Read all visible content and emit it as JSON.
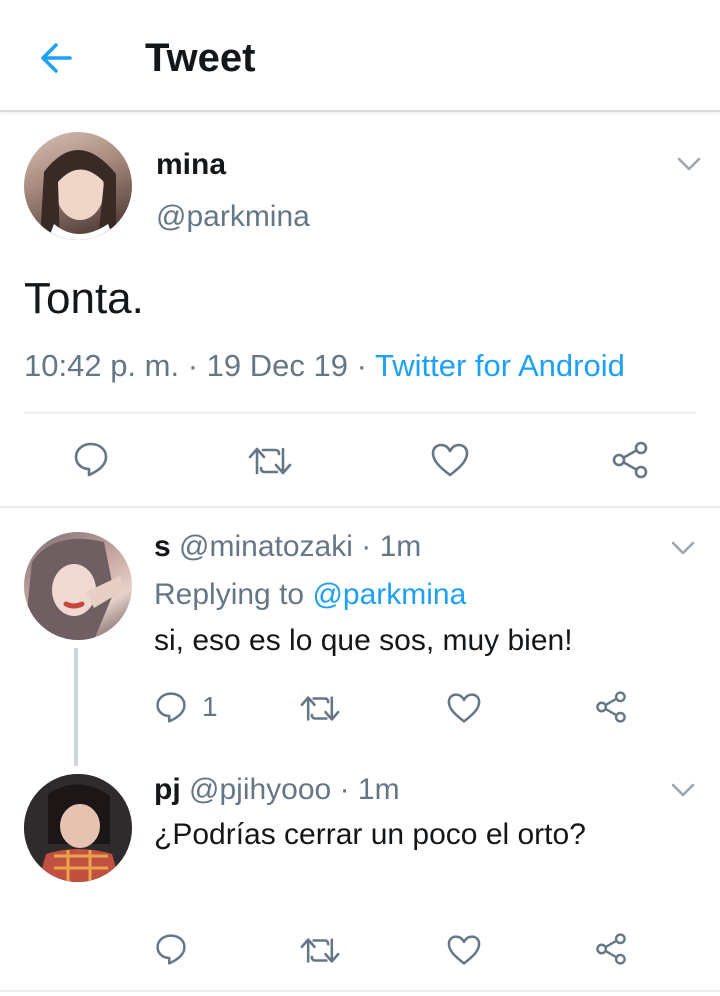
{
  "header": {
    "title": "Tweet",
    "back_icon": "back-arrow-icon"
  },
  "main_tweet": {
    "name": "mina",
    "handle": "@parkmina",
    "text": "Tonta.",
    "time": "10:42 p. m.",
    "date": "19 Dec 19",
    "source": "Twitter for Android",
    "separator": " · "
  },
  "replies": [
    {
      "name": "s",
      "handle": "@minatozaki",
      "age": "1m",
      "replying_prefix": "Replying to ",
      "replying_to": "@parkmina",
      "text": "si, eso es lo que sos, muy bien!",
      "reply_count": "1"
    },
    {
      "name": "pj",
      "handle": "@pjihyooo",
      "age": "1m",
      "text": "¿Podrías cerrar un poco el orto?"
    }
  ],
  "colors": {
    "accent": "#1da1f2",
    "secondary_text": "#657786",
    "icon": "#657786"
  },
  "icons": [
    "reply-icon",
    "retweet-icon",
    "like-icon",
    "share-icon",
    "chevron-down-icon"
  ]
}
